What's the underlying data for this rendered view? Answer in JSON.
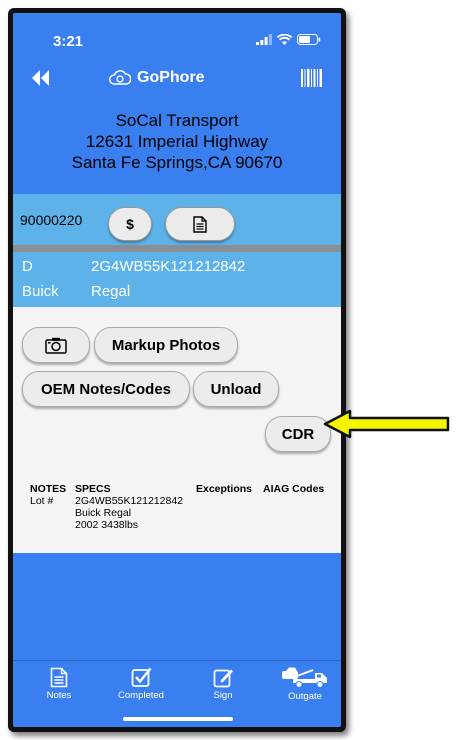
{
  "status": {
    "time": "3:21"
  },
  "header": {
    "app_name": "GoPhore"
  },
  "address": {
    "company": "SoCal Transport",
    "street": "12631 Imperial Highway",
    "city_state_zip": "Santa Fe Springs,CA 90670"
  },
  "order": {
    "number": "90000220",
    "dollar_label": "$"
  },
  "vehicle": {
    "code": "D",
    "vin": "2G4WB55K121212842",
    "make": "Buick",
    "model": "Regal"
  },
  "buttons": {
    "markup_photos": "Markup Photos",
    "oem_notes": "OEM Notes/Codes",
    "unload": "Unload",
    "cdr": "CDR"
  },
  "details": {
    "notes_header": "NOTES",
    "specs_header": "SPECS",
    "exceptions_header": "Exceptions",
    "aiag_header": "AIAG Codes",
    "lot_label": "Lot #",
    "specs_lines": [
      "2G4WB55K121212842",
      "Buick Regal",
      "2002 3438lbs"
    ]
  },
  "tabs": [
    {
      "label": "Notes",
      "icon": "notes-icon"
    },
    {
      "label": "Completed",
      "icon": "checkbox-icon"
    },
    {
      "label": "Sign",
      "icon": "sign-icon"
    },
    {
      "label": "Outgate",
      "icon": "tow-truck-icon"
    }
  ],
  "colors": {
    "primary": "#3a7ff0",
    "bar": "#5db2ea",
    "arrow": "#f5f500"
  }
}
